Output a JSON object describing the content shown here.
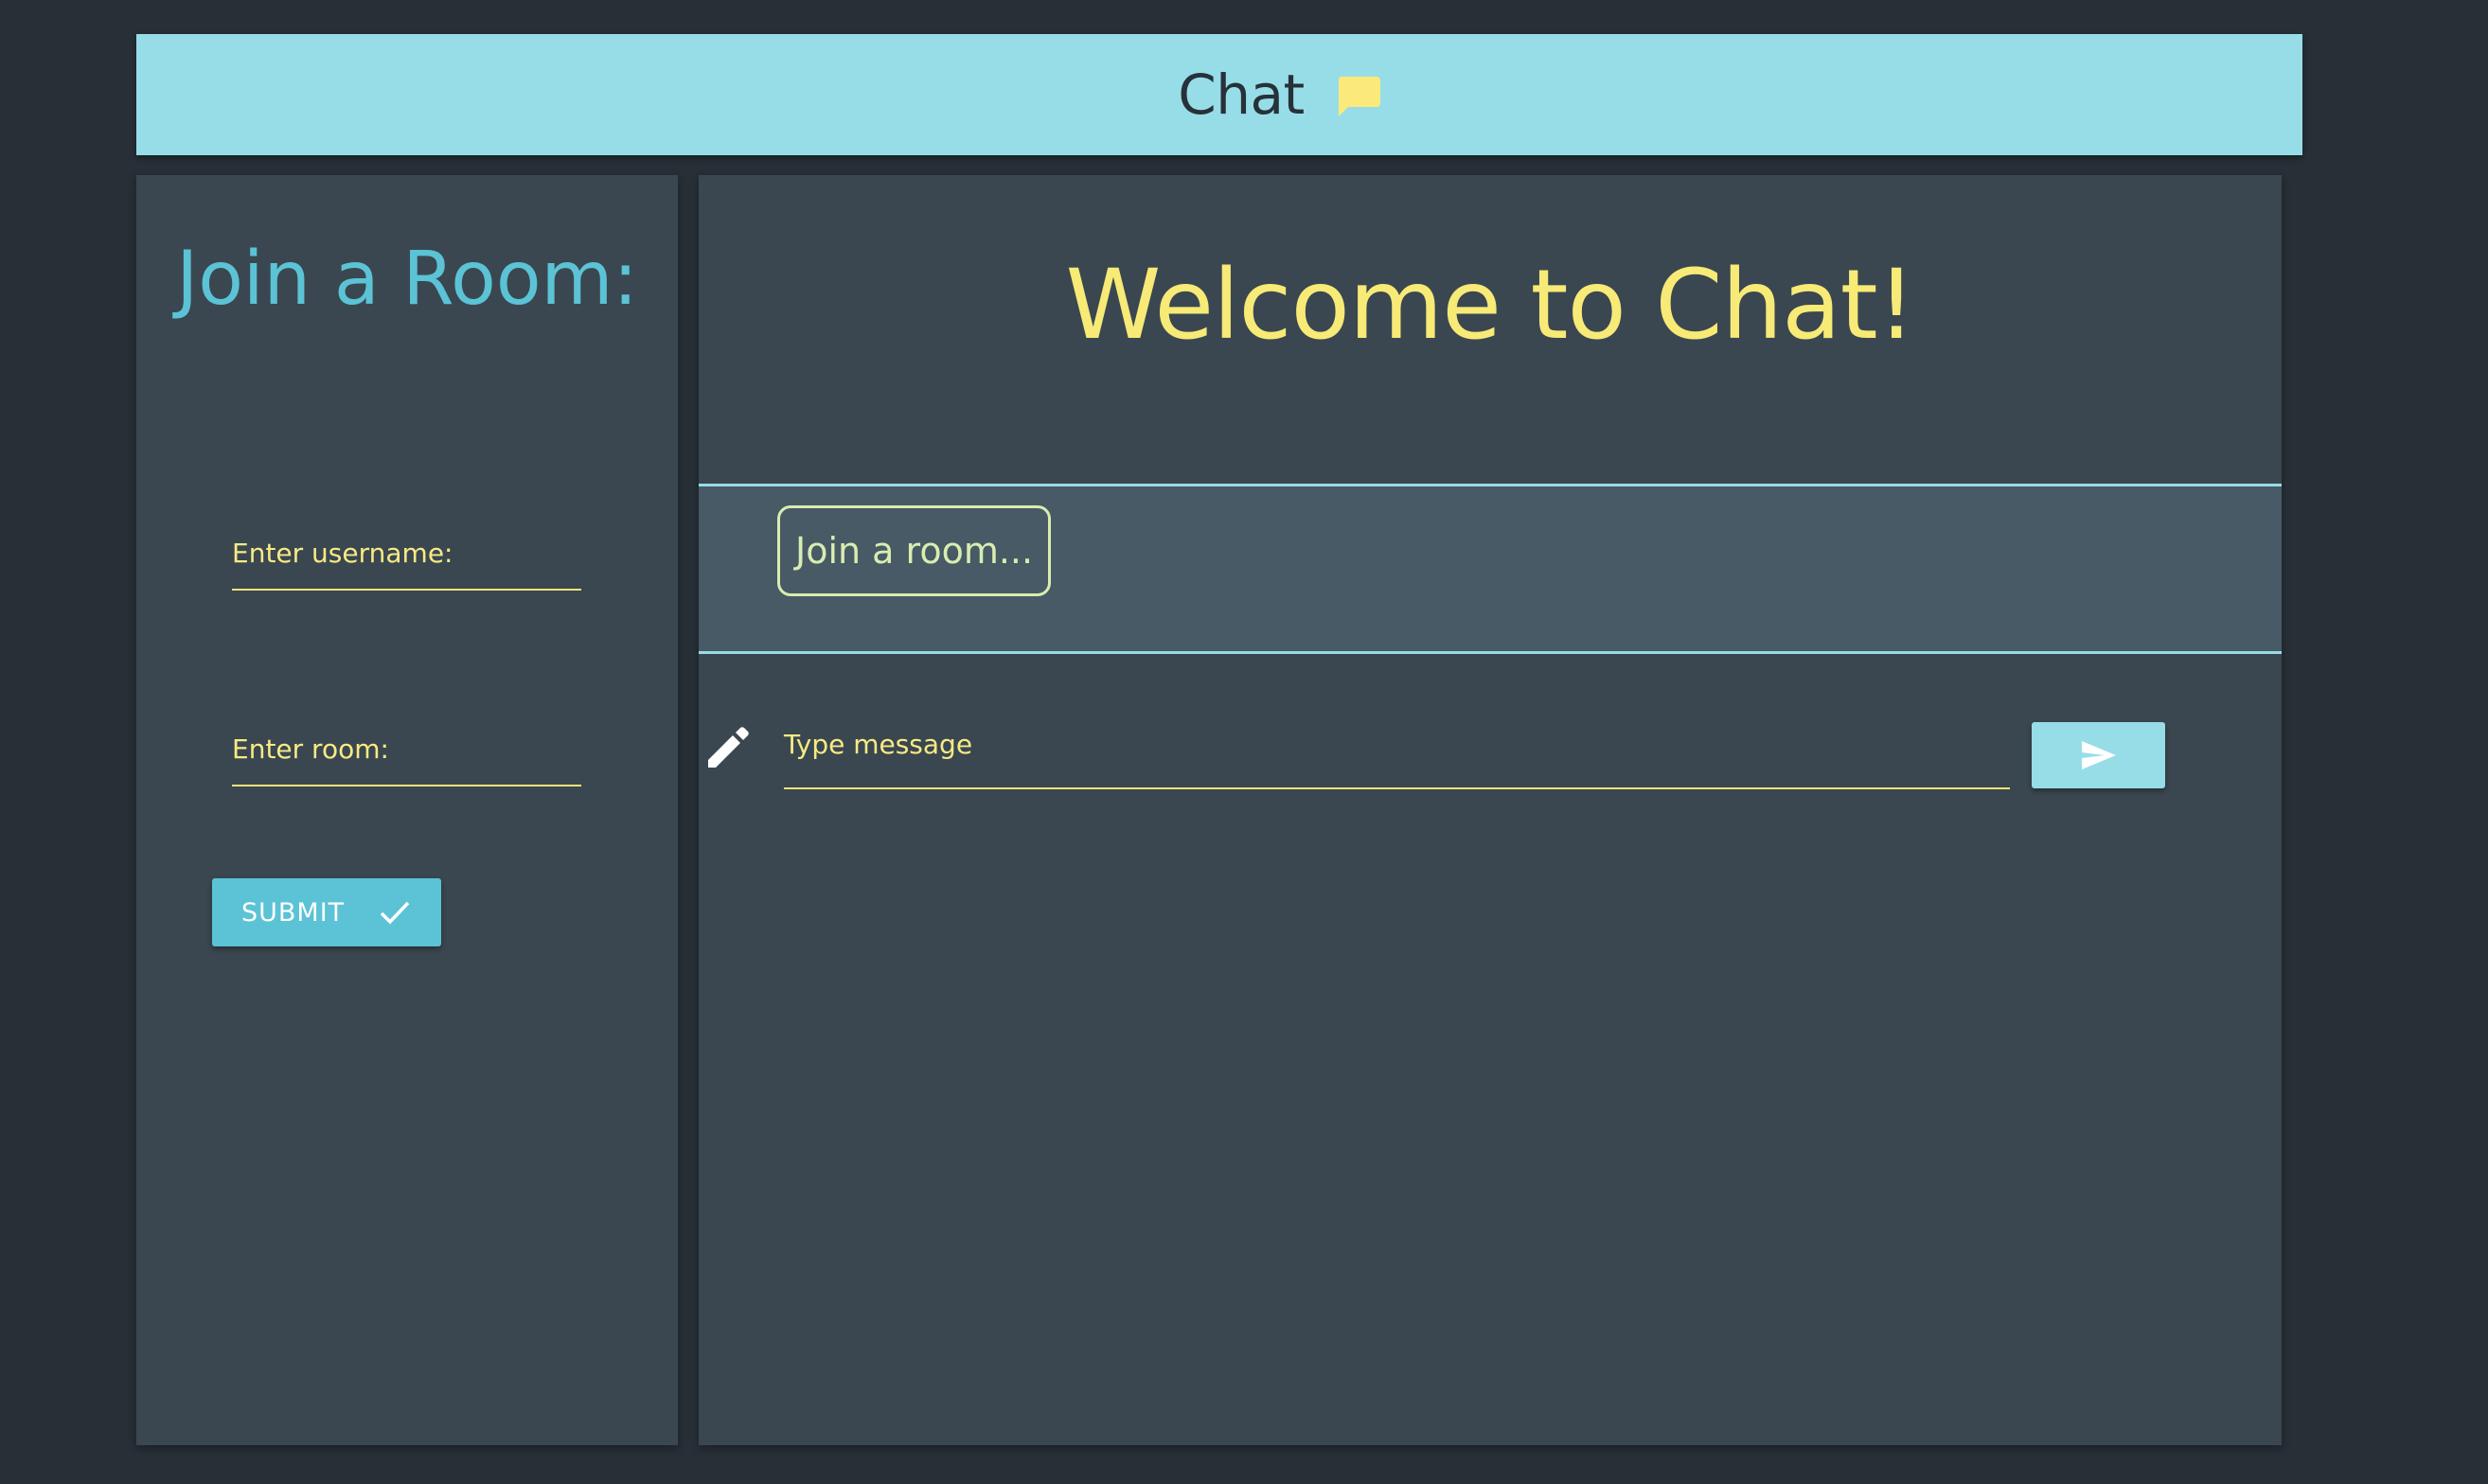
{
  "header": {
    "title": "Chat",
    "icon": "chat-bubble-icon",
    "icon_color": "#fbe97a",
    "background": "#97dde8"
  },
  "sidebar": {
    "title": "Join a Room:",
    "username_label": "Enter username:",
    "room_label": "Enter room:",
    "submit_label": "SUBMIT",
    "submit_icon": "check-icon"
  },
  "main": {
    "welcome": "Welcome to Chat!",
    "room_placeholder": "Join a room...",
    "message_icon": "pencil-icon",
    "message_label": "Type message",
    "send_icon": "send-icon"
  },
  "colors": {
    "background": "#272f37",
    "panel": "#3a4750",
    "accent_blue": "#5bc3d5",
    "accent_yellow": "#f7ea76",
    "room_border": "#d8edb0"
  }
}
